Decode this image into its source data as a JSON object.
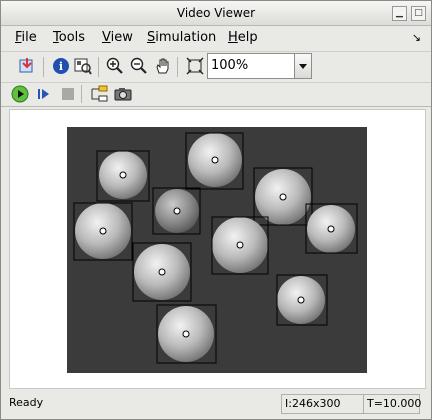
{
  "window": {
    "title": "Video Viewer"
  },
  "menu": {
    "items": [
      {
        "label": "File"
      },
      {
        "label": "Tools"
      },
      {
        "label": "View"
      },
      {
        "label": "Simulation"
      },
      {
        "label": "Help"
      }
    ]
  },
  "toolbar": {
    "zoom_value": "100%"
  },
  "status": {
    "text": "Ready",
    "image_size": "I:246x300",
    "time": "T=10.000"
  }
}
